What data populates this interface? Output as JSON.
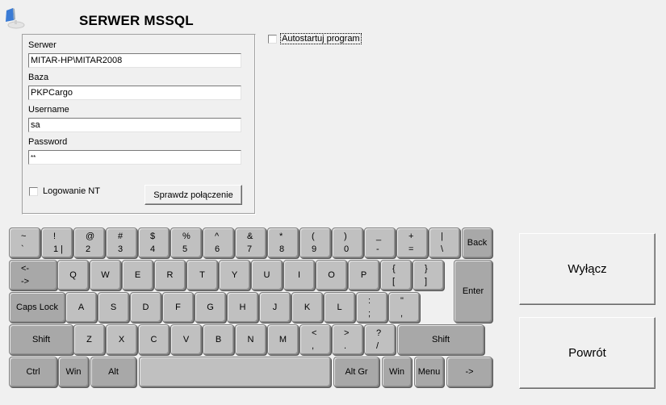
{
  "header": {
    "title": "SERWER MSSQL",
    "logo_icon": "computer-monitor-icon"
  },
  "connection": {
    "server_label": "Serwer",
    "server_value": "MITAR-HP\\MITAR2008",
    "database_label": "Baza",
    "database_value": "PKPCargo",
    "username_label": "Username",
    "username_value": "sa",
    "password_label": "Password",
    "password_value": "**",
    "nt_login_label": "Logowanie NT",
    "nt_login_checked": false,
    "test_button": "Sprawdz połączenie"
  },
  "autostart": {
    "label": "Autostartuj program",
    "checked": false
  },
  "actions": {
    "shutdown": "Wyłącz",
    "back": "Powrót"
  },
  "keyboard": {
    "row1": [
      {
        "top": "~",
        "bot": "`"
      },
      {
        "top": "!",
        "bot": "1 |"
      },
      {
        "top": "@",
        "bot": "2"
      },
      {
        "top": "#",
        "bot": "3"
      },
      {
        "top": "$",
        "bot": "4"
      },
      {
        "top": "%",
        "bot": "5"
      },
      {
        "top": "^",
        "bot": "6"
      },
      {
        "top": "&",
        "bot": "7"
      },
      {
        "top": "*",
        "bot": "8"
      },
      {
        "top": "(",
        "bot": "9"
      },
      {
        "top": ")",
        "bot": "0"
      },
      {
        "top": "_",
        "bot": "-"
      },
      {
        "top": "+",
        "bot": "="
      },
      {
        "top": "|",
        "bot": "\\"
      }
    ],
    "back": "Back",
    "tab": {
      "top": "<-",
      "bot": "->"
    },
    "row2": [
      "Q",
      "W",
      "E",
      "R",
      "T",
      "Y",
      "U",
      "I",
      "O",
      "P"
    ],
    "row2_brackets": [
      {
        "top": "{",
        "bot": "["
      },
      {
        "top": "}",
        "bot": "]"
      }
    ],
    "enter": "Enter",
    "caps": "Caps Lock",
    "row3": [
      "A",
      "S",
      "D",
      "F",
      "G",
      "H",
      "J",
      "K",
      "L"
    ],
    "row3_punct": [
      {
        "top": ":",
        "bot": ";"
      },
      {
        "top": "\"",
        "bot": ","
      }
    ],
    "shift_left": "Shift",
    "row4": [
      "Z",
      "X",
      "C",
      "V",
      "B",
      "N",
      "M"
    ],
    "row4_punct": [
      {
        "top": "<",
        "bot": ","
      },
      {
        "top": ">",
        "bot": "."
      },
      {
        "top": "?",
        "bot": "/"
      }
    ],
    "shift_right": "Shift",
    "ctrl": "Ctrl",
    "win_left": "Win",
    "alt": "Alt",
    "space": "",
    "altgr": "Alt Gr",
    "win_right": "Win",
    "menu": "Menu",
    "arrow": "->"
  }
}
